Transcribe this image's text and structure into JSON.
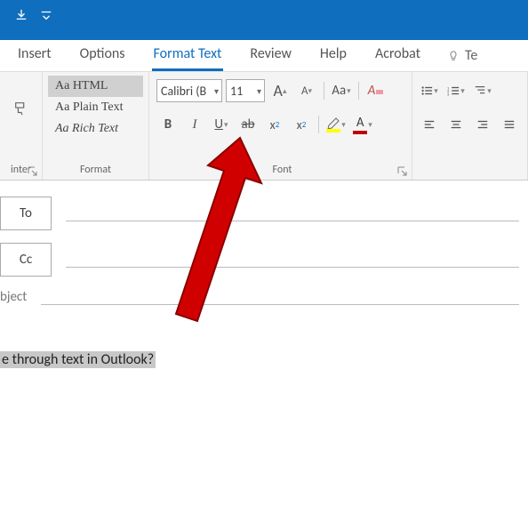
{
  "qat": {
    "save_tip": "Save",
    "customize_tip": "Customize"
  },
  "tabs": {
    "insert": "Insert",
    "options": "Options",
    "format_text": "Format Text",
    "review": "Review",
    "help": "Help",
    "acrobat": "Acrobat",
    "tell_me_label": "Te"
  },
  "ribbon": {
    "clipboard": {
      "group_label": "inter"
    },
    "format_group": {
      "html": "Aa HTML",
      "plain": "Aa Plain Text",
      "rich": "Aa Rich Text",
      "group_label": "Format"
    },
    "font_group": {
      "font_name": "Calibri (B",
      "font_size": "11",
      "group_label": "Font",
      "bold": "B",
      "italic": "I",
      "underline": "U",
      "strike": "ab",
      "sub": "x",
      "sup": "x",
      "grow": "A",
      "shrink": "A",
      "caps": "Aa",
      "clear": "A",
      "highlight_color": "#ffff00",
      "font_color": "#c00000"
    },
    "paragraph_group": {
      "group_label": ""
    }
  },
  "compose": {
    "to_label": "To",
    "cc_label": "Cc",
    "subject_label": "bject",
    "body_text": "e through text in Outlook?"
  },
  "colors": {
    "accent": "#106ebe"
  },
  "annotation": {
    "description": "Large red arrow pointing at the Strikethrough button in the Font group"
  }
}
